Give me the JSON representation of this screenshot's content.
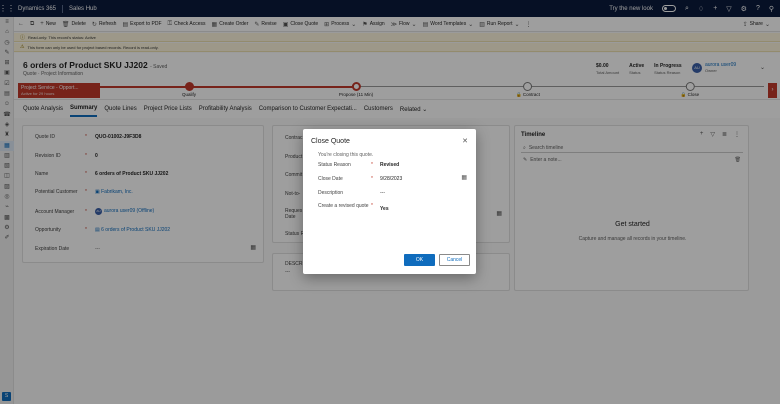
{
  "topbar": {
    "brand": "Dynamics 365",
    "app": "Sales Hub",
    "try_new_look": "Try the new look"
  },
  "commands": {
    "new": "New",
    "delete": "Delete",
    "refresh": "Refresh",
    "export_pdf": "Export to PDF",
    "check_access": "Check Access",
    "create_order": "Create Order",
    "revise": "Revise",
    "close_quote": "Close Quote",
    "process": "Process",
    "assign": "Assign",
    "flow": "Flow",
    "word_templates": "Word Templates",
    "run_report": "Run Report",
    "share": "Share"
  },
  "notices": {
    "read_only": "Read-only: This record's status: Active",
    "project_based": "This form can only be used for project based records. Record is read-only."
  },
  "header": {
    "title": "6 orders of Product SKU JJ202",
    "saved": "- Saved",
    "subtitle": "Quote · Project Information",
    "total_amount": "$0.00",
    "total_amount_label": "Total Amount",
    "status": "Active",
    "status_label": "Status",
    "status_reason": "In Progress",
    "status_reason_label": "Status Reason",
    "owner_initials": "AU",
    "owner_name": "aurora user09",
    "owner_label": "Owner"
  },
  "bpf": {
    "flag_title": "Project Service - Opport...",
    "flag_sub": "Active for 29 hours",
    "stages": [
      {
        "label": "Qualify",
        "state": "done"
      },
      {
        "label": "Propose (11 Min)",
        "state": "current"
      },
      {
        "label": "Contract",
        "state": "locked"
      },
      {
        "label": "Close",
        "state": "locked"
      }
    ]
  },
  "tabs": [
    "Quote Analysis",
    "Summary",
    "Quote Lines",
    "Project Price Lists",
    "Profitability Analysis",
    "Comparison to Customer Expectati...",
    "Customers",
    "Related"
  ],
  "active_tab": "Summary",
  "summary": {
    "quote_id_label": "Quote ID",
    "quote_id": "QUO-01002-J9F3D8",
    "revision_label": "Revision ID",
    "revision": "0",
    "name_label": "Name",
    "name": "6 orders of Product SKU JJ202",
    "potential_customer_label": "Potential Customer",
    "potential_customer": "Fabrikam, Inc.",
    "account_manager_label": "Account Manager",
    "account_manager_initials": "AU",
    "account_manager": "aurora user09 (Offline)",
    "opportunity_label": "Opportunity",
    "opportunity": "6 orders of Product SKU JJ202",
    "expiration_label": "Expiration Date",
    "expiration": "---"
  },
  "mid_labels": [
    "Contrac",
    "Product",
    "Commit",
    "Not-to-",
    "Reques Date",
    "Status R"
  ],
  "desc_label": "DESCRI",
  "desc_value": "---",
  "timeline": {
    "title": "Timeline",
    "search_placeholder": "Search timeline",
    "note_placeholder": "Enter a note...",
    "empty_title": "Get started",
    "empty_sub": "Capture and manage all records in your timeline."
  },
  "dialog": {
    "title": "Close Quote",
    "message": "You're closing this quote.",
    "status_reason_label": "Status Reason",
    "status_reason": "Revised",
    "close_date_label": "Close Date",
    "close_date": "9/28/2023",
    "description_label": "Description",
    "description": "---",
    "create_revised_label": "Create a revised quote",
    "create_revised": "Yes",
    "ok": "OK",
    "cancel": "Cancel"
  }
}
